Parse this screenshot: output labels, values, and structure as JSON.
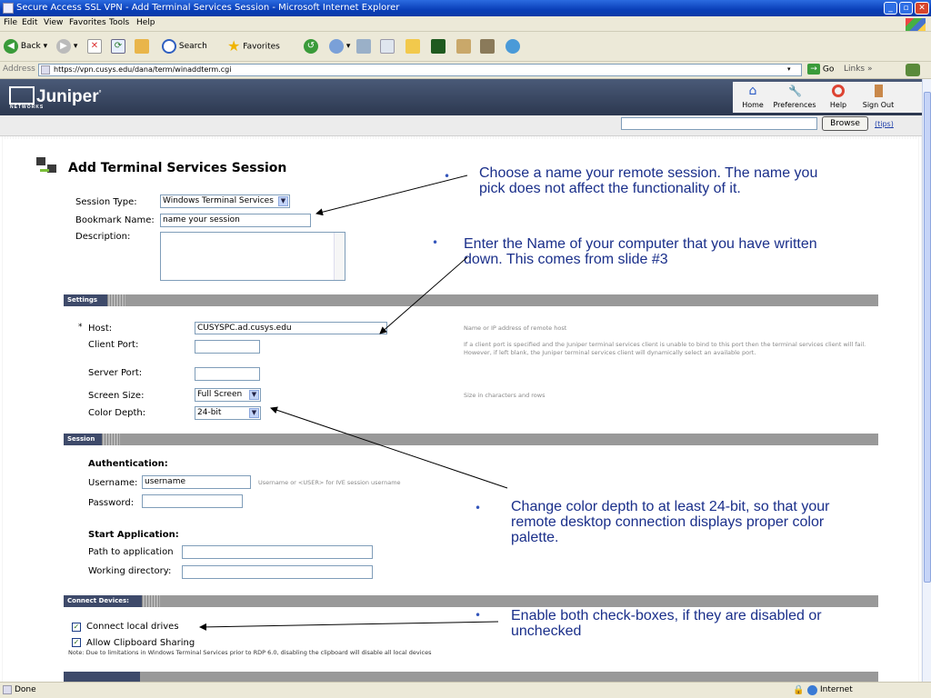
{
  "window": {
    "title": "Secure Access SSL VPN - Add Terminal Services Session - Microsoft Internet Explorer"
  },
  "menu": [
    "File",
    "Edit",
    "View",
    "Favorites",
    "Tools",
    "Help"
  ],
  "toolbar": {
    "back": "Back",
    "search": "Search",
    "favorites": "Favorites"
  },
  "address": {
    "label": "Address",
    "url": "https://vpn.cusys.edu/dana/term/winaddterm.cgi",
    "go": "Go",
    "links": "Links"
  },
  "juniper": {
    "logo": "Juniper",
    "logo_sub": "NETWORKS",
    "nav": [
      "Home",
      "Preferences",
      "Help",
      "Sign Out"
    ],
    "browse": "Browse",
    "tips": "(tips)"
  },
  "form": {
    "heading": "Add Terminal Services Session",
    "session_type_label": "Session Type:",
    "session_type_value": "Windows Terminal Services",
    "bookmark_label": "Bookmark Name:",
    "bookmark_value": "name your session",
    "description_label": "Description:"
  },
  "settings": {
    "title": "Settings",
    "host_marker": "*",
    "host_label": "Host:",
    "host_value": "CUSYSPC.ad.cusys.edu",
    "host_hint": "Name or IP address of remote host",
    "client_port_label": "Client Port:",
    "client_port_hint": "If a client port is specified and the Juniper terminal services client is unable to bind to this port then the terminal services client will fail. However, if left blank, the Juniper terminal services client will dynamically select an available port.",
    "server_port_label": "Server Port:",
    "screen_size_label": "Screen Size:",
    "screen_size_value": "Full Screen",
    "screen_size_hint": "Size in characters and rows",
    "color_depth_label": "Color Depth:",
    "color_depth_value": "24-bit"
  },
  "session": {
    "title": "Session",
    "auth_heading": "Authentication:",
    "username_label": "Username:",
    "username_value": "username",
    "username_hint": "Username or <USER> for IVE session username",
    "password_label": "Password:",
    "start_app_heading": "Start Application:",
    "path_label": "Path to application",
    "workdir_label": "Working directory:"
  },
  "devices": {
    "title": "Connect Devices:",
    "connect_drives": "Connect local drives",
    "clipboard": "Allow Clipboard Sharing",
    "note": "Note: Due to limitations in Windows Terminal Services prior to RDP 6.0, disabling the clipboard will disable all local devices"
  },
  "annotations": {
    "a1": "Choose a name your remote session. The name you pick does not affect the functionality of it.",
    "a2": "Enter the Name of your computer that you have written down. This comes from slide #3",
    "a3": "Change color depth to at least 24-bit, so that your remote desktop connection displays proper color palette.",
    "a4": "Enable both check-boxes, if they are disabled or unchecked"
  },
  "statusbar": {
    "status": "Done",
    "zone": "Internet"
  }
}
